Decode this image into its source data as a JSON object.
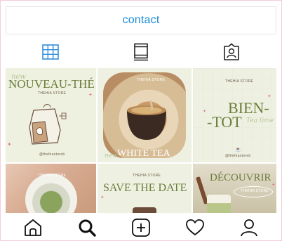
{
  "profile": {
    "contact_label": "contact"
  },
  "tabs": [
    {
      "name": "grid",
      "icon": "grid-icon",
      "active": true
    },
    {
      "name": "reels",
      "icon": "reels-icon",
      "active": false
    },
    {
      "name": "tagged",
      "icon": "tagged-icon",
      "active": false
    }
  ],
  "posts": {
    "p1": {
      "title": "NOUVEAU-THÉ",
      "script": "new",
      "store": "THEHIA STORE",
      "handle": "@thehiastoreb"
    },
    "p2": {
      "store": "THEHIA STORE",
      "title": "WHITE TEA",
      "script": "new"
    },
    "p3": {
      "store": "THEHIA STORE",
      "title_line1": "BIEN-",
      "title_line2": "-TOT",
      "script": "Tea time",
      "handle": "@thehiastoreb"
    },
    "p4": {
      "store": "THEHIA STORE"
    },
    "p5": {
      "store": "THEHIA STORE",
      "title": "SAVE THE DATE"
    },
    "p6": {
      "title": "DÉCOUVRIR",
      "store": "THEHIA STORE"
    }
  },
  "colors": {
    "accent_blue": "#1c8bd8",
    "olive": "#6c7d3b",
    "cream": "#eef1e2"
  },
  "bottom_nav": [
    {
      "icon": "home-icon"
    },
    {
      "icon": "search-icon"
    },
    {
      "icon": "create-icon"
    },
    {
      "icon": "activity-heart-icon"
    },
    {
      "icon": "profile-icon"
    }
  ]
}
